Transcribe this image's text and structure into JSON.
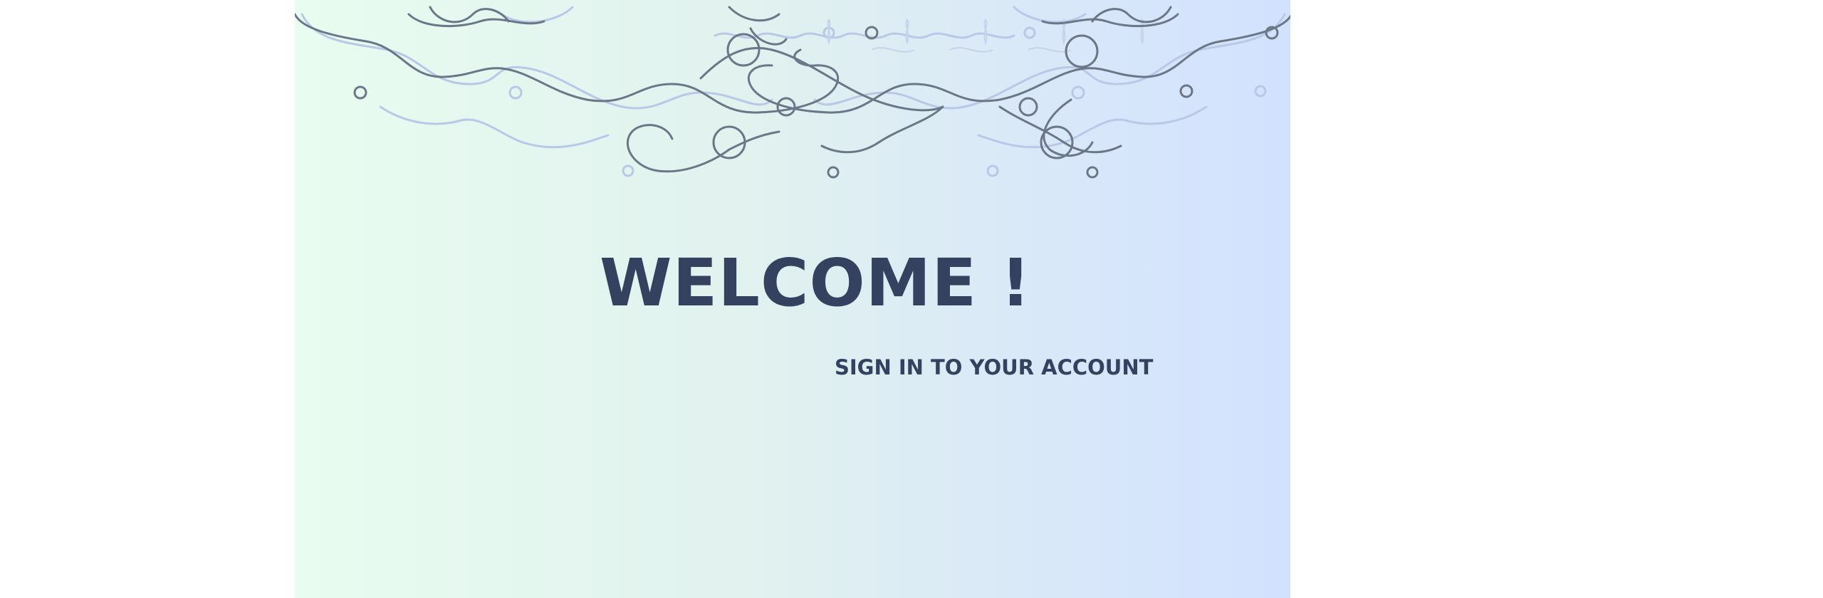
{
  "welcome": {
    "title": "WELCOME !",
    "subtitle": "SIGN IN TO YOUR ACCOUNT"
  },
  "colors": {
    "text": "#34425f",
    "ornament_dark": "#6b7687",
    "ornament_light": "#b9c8e6",
    "gradient_left": "#e8fcef",
    "gradient_right": "#d2e2fe",
    "background": "#ffffff"
  },
  "icons": {
    "ornament": "filigree-flourish-icon"
  }
}
